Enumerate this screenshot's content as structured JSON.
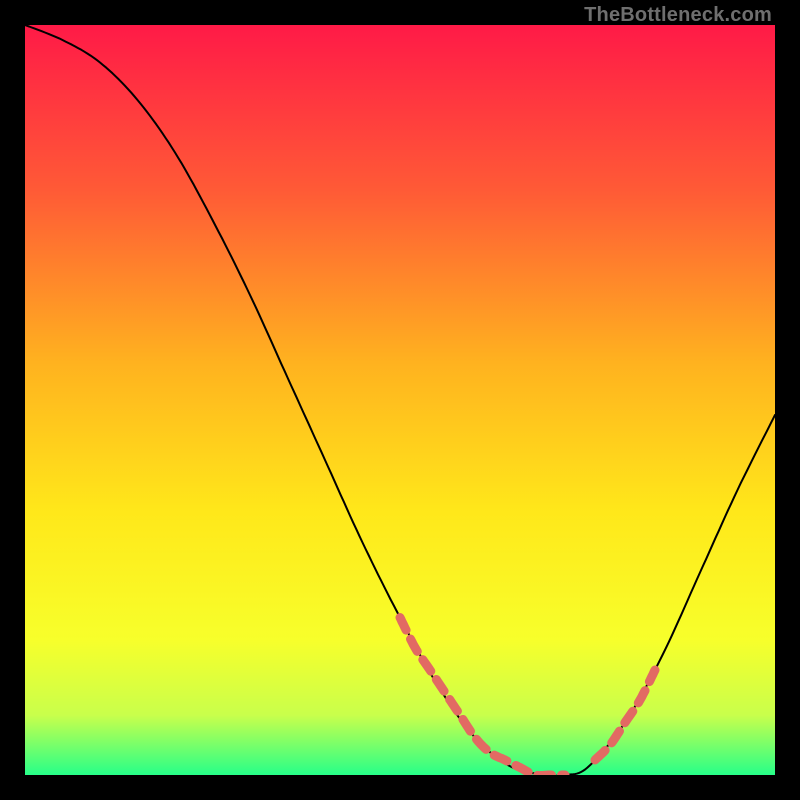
{
  "watermark": "TheBottleneck.com",
  "colors": {
    "background": "#000000",
    "gradient_top": "#ff1a47",
    "gradient_upper_mid": "#ff6a2b",
    "gradient_mid": "#ffd21a",
    "gradient_lower_mid": "#fff92b",
    "gradient_near_bottom": "#d6ff4b",
    "gradient_bottom": "#27ff89",
    "curve": "#000000",
    "curve_highlight": "#e26a63",
    "watermark_text": "#6f6f6f"
  },
  "chart_data": {
    "type": "line",
    "title": "",
    "xlabel": "",
    "ylabel": "",
    "xlim": [
      0,
      100
    ],
    "ylim": [
      0,
      100
    ],
    "grid": false,
    "legend": false,
    "annotations": [
      "TheBottleneck.com"
    ],
    "series": [
      {
        "name": "bottleneck-curve",
        "x": [
          0,
          5,
          10,
          15,
          20,
          25,
          30,
          35,
          40,
          45,
          50,
          55,
          60,
          65,
          70,
          72,
          75,
          80,
          85,
          90,
          95,
          100
        ],
        "values": [
          100,
          98,
          95,
          90,
          83,
          74,
          64,
          53,
          42,
          31,
          21,
          12,
          5,
          1,
          0,
          0,
          1,
          7,
          16,
          27,
          38,
          48
        ]
      }
    ],
    "highlight_segments": [
      {
        "name": "left-highlight",
        "x": [
          50,
          52,
          54,
          56,
          58,
          60,
          62,
          64,
          66,
          68,
          70,
          72
        ],
        "values": [
          21,
          17,
          14,
          11,
          8,
          5,
          3,
          2,
          1,
          0,
          0,
          0
        ]
      },
      {
        "name": "right-highlight",
        "x": [
          76,
          78,
          80,
          82,
          84
        ],
        "values": [
          2,
          4,
          7,
          10,
          14
        ]
      }
    ]
  }
}
